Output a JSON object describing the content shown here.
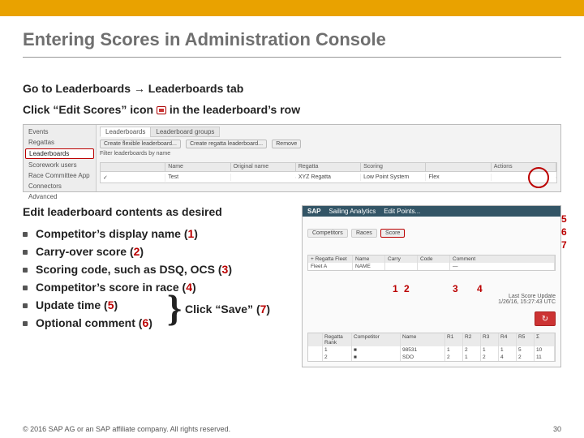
{
  "title": "Entering Scores in Administration Console",
  "step1": {
    "pre": "Go to Leaderboards ",
    "arrow": "→",
    "post": " Leaderboards tab"
  },
  "step2": {
    "pre": "Click “Edit Scores” icon ",
    "post": " in the leaderboard’s row"
  },
  "admin": {
    "sidebar": [
      "Events",
      "Regattas",
      "Leaderboards",
      "Scorework users",
      "Race Committee App",
      "Connectors",
      "Advanced"
    ],
    "tabs": [
      "Leaderboards",
      "Leaderboard groups"
    ],
    "btns": [
      "Create flexible leaderboard...",
      "Create regatta leaderboard...",
      "Remove"
    ],
    "filter": "Filter leaderboards by name",
    "headers": [
      "",
      "Name",
      "Original name",
      "Regatta",
      "Scoring",
      "",
      "Actions"
    ],
    "row": [
      "✓",
      "Test",
      "",
      "XYZ Regatta",
      "Low Point System",
      "Flex",
      ""
    ]
  },
  "instr": {
    "head": "Edit leaderboard contents as desired",
    "items": [
      {
        "text": "Competitor’s display name",
        "n": "1"
      },
      {
        "text": "Carry-over score",
        "n": "2"
      },
      {
        "text": "Scoring code, such as DSQ, OCS",
        "n": "3"
      },
      {
        "text": "Competitor’s score in race",
        "n": "4"
      },
      {
        "text": "Update time",
        "n": "5"
      },
      {
        "text": "Optional comment",
        "n": "6"
      }
    ],
    "save": {
      "label": "Click “Save”",
      "n": "7"
    }
  },
  "edit": {
    "logo": "SAP",
    "product": "Sailing Analytics",
    "modal": "Edit Points...",
    "tabs": [
      "Competitors",
      "Races",
      "Score"
    ],
    "grid1": {
      "hdr": [
        "+ Regatta Fleet",
        "Name",
        "Carry",
        "Code",
        "Comment"
      ],
      "row": [
        "Fleet A",
        "NAME",
        "",
        "",
        "—"
      ]
    },
    "last": {
      "label": "Last Score Update",
      "time": "1/26/16, 15:27:43 UTC"
    },
    "grid2": {
      "hdr": [
        "",
        "Regatta Rank",
        "Competitor",
        "Name",
        "R1",
        "R2",
        "R3",
        "R4",
        "R5",
        "Σ"
      ],
      "rows": [
        [
          "",
          "1",
          "■",
          "98531",
          "1",
          "2",
          "1",
          "1",
          "5",
          "10"
        ],
        [
          "",
          "2",
          "■",
          "SDO",
          "2",
          "1",
          "2",
          "4",
          "2",
          "11"
        ]
      ]
    }
  },
  "callouts": {
    "n1": "1",
    "n2": "2",
    "n3": "3",
    "n4": "4",
    "n5": "5",
    "n6": "6",
    "n7": "7"
  },
  "footer": {
    "copy": "© 2016 SAP AG or an SAP affiliate company. All rights reserved.",
    "page": "30"
  }
}
